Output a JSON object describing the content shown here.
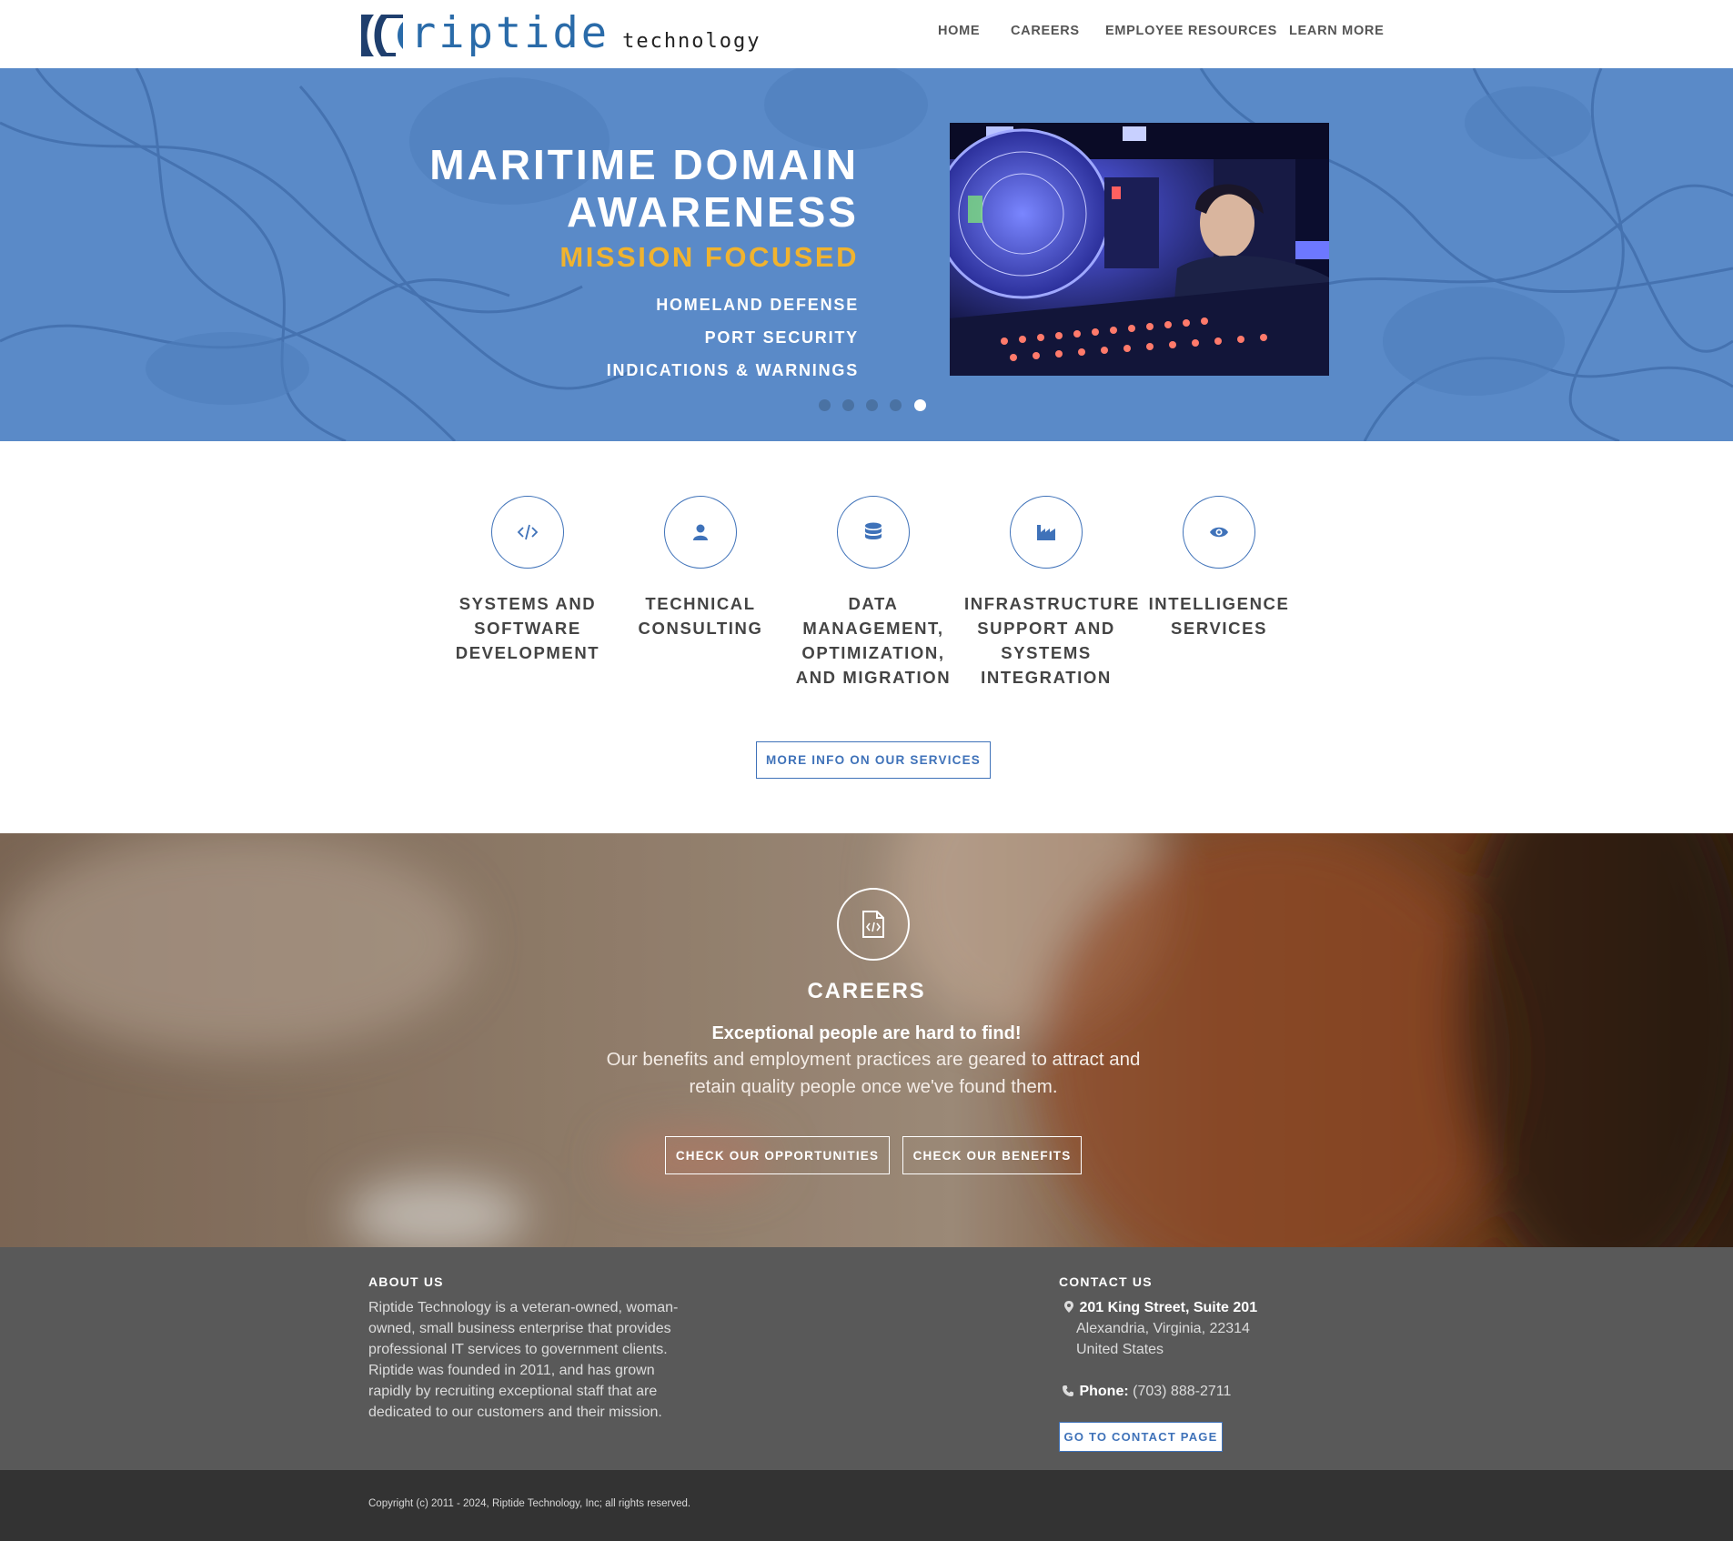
{
  "header": {
    "logo_word": "riptide",
    "logo_tagline": "technology",
    "nav": [
      "HOME",
      "CAREERS",
      "EMPLOYEE RESOURCES",
      "LEARN MORE"
    ]
  },
  "hero": {
    "title_line1": "MARITIME DOMAIN",
    "title_line2": "AWARENESS",
    "subtitle": "MISSION FOCUSED",
    "items": [
      "HOMELAND DEFENSE",
      "PORT SECURITY",
      "INDICATIONS & WARNINGS"
    ],
    "slide_count": 5,
    "active_slide": 5,
    "accent_color": "#f0b32f",
    "background_color": "#5a8ac8"
  },
  "services": {
    "items": [
      {
        "icon": "code-icon",
        "label": "SYSTEMS AND SOFTWARE DEVELOPMENT"
      },
      {
        "icon": "user-icon",
        "label": "TECHNICAL CONSULTING"
      },
      {
        "icon": "database-icon",
        "label": "DATA MANAGEMENT, OPTIMIZATION, AND MIGRATION"
      },
      {
        "icon": "industry-icon",
        "label": "INFRASTRUCTURE SUPPORT AND SYSTEMS INTEGRATION"
      },
      {
        "icon": "eye-icon",
        "label": "INTELLIGENCE SERVICES"
      }
    ],
    "button_label": "MORE INFO ON OUR SERVICES",
    "accent_color": "#3f72b9"
  },
  "careers": {
    "icon": "file-code-icon",
    "title": "CAREERS",
    "bold_text": "Exceptional people are hard to find!",
    "text": "Our benefits and employment practices are geared to attract and retain quality people once we've found them.",
    "button_opportunities": "CHECK OUR OPPORTUNITIES",
    "button_benefits": "CHECK OUR BENEFITS"
  },
  "footer": {
    "about_heading": "ABOUT US",
    "about_text": "Riptide Technology is a veteran-owned, woman-owned, small business enterprise that provides professional IT services to government clients. Riptide was founded in 2011, and has grown rapidly by recruiting exceptional staff that are dedicated to our customers and their mission.",
    "contact_heading": "CONTACT US",
    "address_line1": "201 King Street, Suite 201",
    "address_line2": "Alexandria, Virginia, 22314",
    "address_line3": "United States",
    "phone_label": "Phone:",
    "phone_number": "(703) 888-2711",
    "contact_button": "GO TO CONTACT PAGE",
    "copyright": "Copyright (c) 2011 - 2024, Riptide Technology, Inc; all rights reserved."
  }
}
